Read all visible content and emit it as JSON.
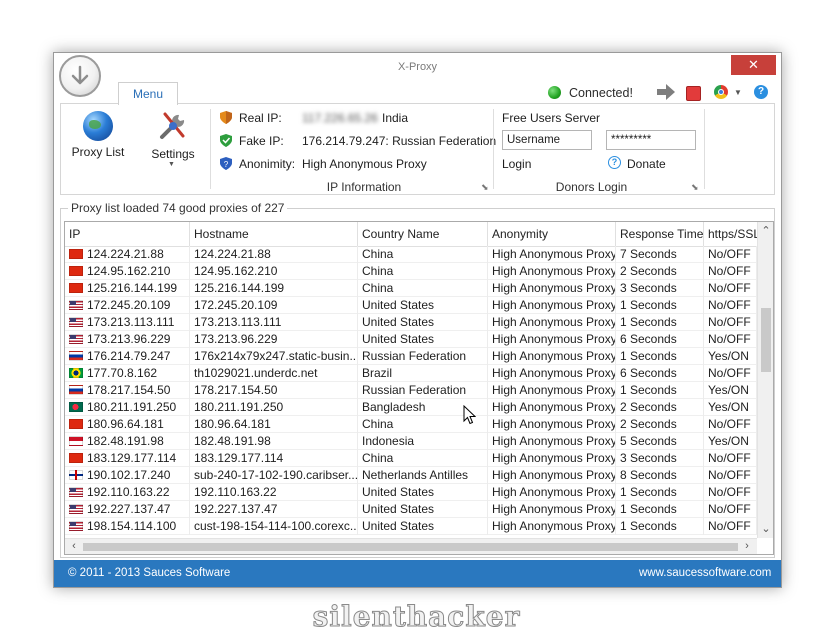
{
  "window": {
    "title": "X-Proxy",
    "close_glyph": "✕"
  },
  "menu_tab": {
    "label": "Menu"
  },
  "connection": {
    "status": "Connected!",
    "status_color": "#22a322"
  },
  "toolbar": {
    "icons": [
      "arrow-right-icon",
      "stop-icon",
      "chrome-icon",
      "help-icon"
    ],
    "help_glyph": "?"
  },
  "ribbon": {
    "proxy_list_label": "Proxy List",
    "settings_label": "Settings",
    "ip_info": {
      "real_ip_label": "Real IP:",
      "real_ip_value": "117.226.65.26",
      "real_ip_country": "India",
      "fake_ip_label": "Fake IP:",
      "fake_ip_value": "176.214.79.247: Russian Federation",
      "anonimity_label": "Anonimity:",
      "anonimity_value": "High Anonymous Proxy",
      "group_title": "IP Information"
    },
    "donors": {
      "title": "Free Users Server",
      "username_value": "Username",
      "password_value": "*********",
      "login_label": "Login",
      "donate_label": "Donate",
      "group_title": "Donors Login"
    }
  },
  "list": {
    "group_title": "Proxy list loaded 74 good proxies of 227",
    "columns": [
      "IP",
      "Hostname",
      "Country Name",
      "Anonymity",
      "Response Time",
      "https/SSL"
    ],
    "rows": [
      {
        "ip": "124.224.21.88",
        "hostname": "124.224.21.88",
        "country": "China",
        "flag": "cn",
        "anonymity": "High Anonymous Proxy",
        "response": "7 Seconds",
        "ssl": "No/OFF"
      },
      {
        "ip": "124.95.162.210",
        "hostname": "124.95.162.210",
        "country": "China",
        "flag": "cn",
        "anonymity": "High Anonymous Proxy",
        "response": "2 Seconds",
        "ssl": "No/OFF"
      },
      {
        "ip": "125.216.144.199",
        "hostname": "125.216.144.199",
        "country": "China",
        "flag": "cn",
        "anonymity": "High Anonymous Proxy",
        "response": "3 Seconds",
        "ssl": "No/OFF"
      },
      {
        "ip": "172.245.20.109",
        "hostname": "172.245.20.109",
        "country": "United States",
        "flag": "us",
        "anonymity": "High Anonymous Proxy",
        "response": "1 Seconds",
        "ssl": "No/OFF"
      },
      {
        "ip": "173.213.113.111",
        "hostname": "173.213.113.111",
        "country": "United States",
        "flag": "us",
        "anonymity": "High Anonymous Proxy",
        "response": "1 Seconds",
        "ssl": "No/OFF"
      },
      {
        "ip": "173.213.96.229",
        "hostname": "173.213.96.229",
        "country": "United States",
        "flag": "us",
        "anonymity": "High Anonymous Proxy",
        "response": "6 Seconds",
        "ssl": "No/OFF"
      },
      {
        "ip": "176.214.79.247",
        "hostname": "176x214x79x247.static-busin...",
        "country": "Russian Federation",
        "flag": "ru",
        "anonymity": "High Anonymous Proxy",
        "response": "1 Seconds",
        "ssl": "Yes/ON"
      },
      {
        "ip": "177.70.8.162",
        "hostname": "th1029021.underdc.net",
        "country": "Brazil",
        "flag": "br",
        "anonymity": "High Anonymous Proxy",
        "response": "6 Seconds",
        "ssl": "No/OFF"
      },
      {
        "ip": "178.217.154.50",
        "hostname": "178.217.154.50",
        "country": "Russian Federation",
        "flag": "ru",
        "anonymity": "High Anonymous Proxy",
        "response": "1 Seconds",
        "ssl": "Yes/ON"
      },
      {
        "ip": "180.211.191.250",
        "hostname": "180.211.191.250",
        "country": "Bangladesh",
        "flag": "bd",
        "anonymity": "High Anonymous Proxy",
        "response": "2 Seconds",
        "ssl": "Yes/ON"
      },
      {
        "ip": "180.96.64.181",
        "hostname": "180.96.64.181",
        "country": "China",
        "flag": "cn",
        "anonymity": "High Anonymous Proxy",
        "response": "2 Seconds",
        "ssl": "No/OFF"
      },
      {
        "ip": "182.48.191.98",
        "hostname": "182.48.191.98",
        "country": "Indonesia",
        "flag": "id",
        "anonymity": "High Anonymous Proxy",
        "response": "5 Seconds",
        "ssl": "Yes/ON"
      },
      {
        "ip": "183.129.177.114",
        "hostname": "183.129.177.114",
        "country": "China",
        "flag": "cn",
        "anonymity": "High Anonymous Proxy",
        "response": "3 Seconds",
        "ssl": "No/OFF"
      },
      {
        "ip": "190.102.17.240",
        "hostname": "sub-240-17-102-190.caribser...",
        "country": "Netherlands Antilles",
        "flag": "an",
        "anonymity": "High Anonymous Proxy",
        "response": "8 Seconds",
        "ssl": "No/OFF"
      },
      {
        "ip": "192.110.163.22",
        "hostname": "192.110.163.22",
        "country": "United States",
        "flag": "us",
        "anonymity": "High Anonymous Proxy",
        "response": "1 Seconds",
        "ssl": "No/OFF"
      },
      {
        "ip": "192.227.137.47",
        "hostname": "192.227.137.47",
        "country": "United States",
        "flag": "us",
        "anonymity": "High Anonymous Proxy",
        "response": "1 Seconds",
        "ssl": "No/OFF"
      },
      {
        "ip": "198.154.114.100",
        "hostname": "cust-198-154-114-100.corexc...",
        "country": "United States",
        "flag": "us",
        "anonymity": "High Anonymous Proxy",
        "response": "1 Seconds",
        "ssl": "No/OFF"
      }
    ],
    "flag_colors": {
      "cn": "#de2910",
      "us": "#3c3b6e",
      "ru": "#d52b1e",
      "br": "#009c3b",
      "bd": "#006a4e",
      "id": "#ce1126",
      "an": "#012a87"
    }
  },
  "footer": {
    "copyright": "© 2011 - 2013 Sauces Software",
    "website": "www.saucessoftware.com",
    "color": "#2a78bf"
  },
  "watermark": "silenthacker"
}
